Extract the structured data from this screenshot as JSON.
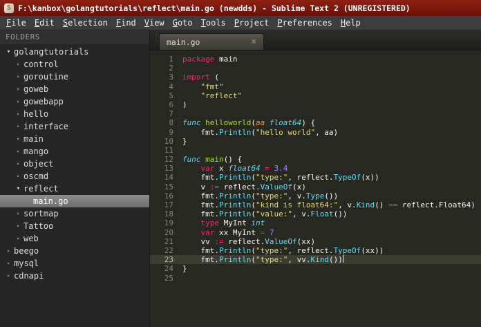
{
  "titlebar": {
    "icon_letter": "S",
    "title": "F:\\kanbox\\golangtutorials\\reflect\\main.go (newdds) - Sublime Text 2 (UNREGISTERED)"
  },
  "menu": {
    "items": [
      "File",
      "Edit",
      "Selection",
      "Find",
      "View",
      "Goto",
      "Tools",
      "Project",
      "Preferences",
      "Help"
    ]
  },
  "sidebar": {
    "header": "FOLDERS",
    "items": [
      {
        "label": "golangtutorials",
        "depth": 0,
        "kind": "folder",
        "state": "expanded",
        "selected": false
      },
      {
        "label": "control",
        "depth": 1,
        "kind": "folder",
        "state": "collapsed",
        "selected": false
      },
      {
        "label": "goroutine",
        "depth": 1,
        "kind": "folder",
        "state": "collapsed",
        "selected": false
      },
      {
        "label": "goweb",
        "depth": 1,
        "kind": "folder",
        "state": "collapsed",
        "selected": false
      },
      {
        "label": "gowebapp",
        "depth": 1,
        "kind": "folder",
        "state": "collapsed",
        "selected": false
      },
      {
        "label": "hello",
        "depth": 1,
        "kind": "folder",
        "state": "collapsed",
        "selected": false
      },
      {
        "label": "interface",
        "depth": 1,
        "kind": "folder",
        "state": "collapsed",
        "selected": false
      },
      {
        "label": "main",
        "depth": 1,
        "kind": "folder",
        "state": "collapsed",
        "selected": false
      },
      {
        "label": "mango",
        "depth": 1,
        "kind": "folder",
        "state": "collapsed",
        "selected": false
      },
      {
        "label": "object",
        "depth": 1,
        "kind": "folder",
        "state": "collapsed",
        "selected": false
      },
      {
        "label": "oscmd",
        "depth": 1,
        "kind": "folder",
        "state": "collapsed",
        "selected": false
      },
      {
        "label": "reflect",
        "depth": 1,
        "kind": "folder",
        "state": "expanded",
        "selected": false
      },
      {
        "label": "main.go",
        "depth": 2,
        "kind": "file",
        "state": "none",
        "selected": true
      },
      {
        "label": "sortmap",
        "depth": 1,
        "kind": "folder",
        "state": "collapsed",
        "selected": false
      },
      {
        "label": "Tattoo",
        "depth": 1,
        "kind": "folder",
        "state": "collapsed",
        "selected": false
      },
      {
        "label": "web",
        "depth": 1,
        "kind": "folder",
        "state": "collapsed",
        "selected": false
      },
      {
        "label": "beego",
        "depth": 0,
        "kind": "folder",
        "state": "collapsed",
        "selected": false
      },
      {
        "label": "mysql",
        "depth": 0,
        "kind": "folder",
        "state": "collapsed",
        "selected": false
      },
      {
        "label": "cdnapi",
        "depth": 0,
        "kind": "folder",
        "state": "collapsed",
        "selected": false
      }
    ]
  },
  "tab": {
    "label": "main.go",
    "close_glyph": "×"
  },
  "editor": {
    "active_line": 23,
    "lines": [
      {
        "n": 1,
        "segs": [
          [
            "package",
            "kw"
          ],
          [
            " main",
            "pl"
          ]
        ]
      },
      {
        "n": 2,
        "segs": []
      },
      {
        "n": 3,
        "segs": [
          [
            "import",
            "kw"
          ],
          [
            " (",
            "pl"
          ]
        ]
      },
      {
        "n": 4,
        "segs": [
          [
            "    ",
            "pl"
          ],
          [
            "\"fmt\"",
            "st"
          ]
        ]
      },
      {
        "n": 5,
        "segs": [
          [
            "    ",
            "pl"
          ],
          [
            "\"reflect\"",
            "st"
          ]
        ]
      },
      {
        "n": 6,
        "segs": [
          [
            ")",
            "pl"
          ]
        ]
      },
      {
        "n": 7,
        "segs": []
      },
      {
        "n": 8,
        "segs": [
          [
            "func",
            "ty"
          ],
          [
            " ",
            "pl"
          ],
          [
            "helloworld",
            "fn"
          ],
          [
            "(",
            "pl"
          ],
          [
            "aa",
            "pm"
          ],
          [
            " ",
            "pl"
          ],
          [
            "float64",
            "ty"
          ],
          [
            ") {",
            "pl"
          ]
        ]
      },
      {
        "n": 9,
        "segs": [
          [
            "    fmt.",
            "pl"
          ],
          [
            "Println",
            "sf"
          ],
          [
            "(",
            "pl"
          ],
          [
            "\"hello world\"",
            "st"
          ],
          [
            ", aa)",
            "pl"
          ]
        ]
      },
      {
        "n": 10,
        "segs": [
          [
            "}",
            "pl"
          ]
        ]
      },
      {
        "n": 11,
        "segs": []
      },
      {
        "n": 12,
        "segs": [
          [
            "func",
            "ty"
          ],
          [
            " ",
            "pl"
          ],
          [
            "main",
            "fn"
          ],
          [
            "() {",
            "pl"
          ]
        ]
      },
      {
        "n": 13,
        "segs": [
          [
            "    ",
            "pl"
          ],
          [
            "var",
            "kw"
          ],
          [
            " x ",
            "pl"
          ],
          [
            "float64",
            "ty"
          ],
          [
            " ",
            "pl"
          ],
          [
            "=",
            "op"
          ],
          [
            " ",
            "pl"
          ],
          [
            "3.4",
            "nm"
          ]
        ]
      },
      {
        "n": 14,
        "segs": [
          [
            "    fmt.",
            "pl"
          ],
          [
            "Println",
            "sf"
          ],
          [
            "(",
            "pl"
          ],
          [
            "\"type:\"",
            "st"
          ],
          [
            ", reflect.",
            "pl"
          ],
          [
            "TypeOf",
            "sf"
          ],
          [
            "(x))",
            "pl"
          ]
        ]
      },
      {
        "n": 15,
        "segs": [
          [
            "    v ",
            "pl"
          ],
          [
            ":=",
            "op"
          ],
          [
            " reflect.",
            "pl"
          ],
          [
            "ValueOf",
            "sf"
          ],
          [
            "(x)",
            "pl"
          ]
        ]
      },
      {
        "n": 16,
        "segs": [
          [
            "    fmt.",
            "pl"
          ],
          [
            "Println",
            "sf"
          ],
          [
            "(",
            "pl"
          ],
          [
            "\"type:\"",
            "st"
          ],
          [
            ", v.",
            "pl"
          ],
          [
            "Type",
            "sf"
          ],
          [
            "())",
            "pl"
          ]
        ]
      },
      {
        "n": 17,
        "segs": [
          [
            "    fmt.",
            "pl"
          ],
          [
            "Println",
            "sf"
          ],
          [
            "(",
            "pl"
          ],
          [
            "\"kind is float64:\"",
            "st"
          ],
          [
            ", v.",
            "pl"
          ],
          [
            "Kind",
            "sf"
          ],
          [
            "() ",
            "pl"
          ],
          [
            "==",
            "op"
          ],
          [
            " reflect.Float64)",
            "pl"
          ]
        ]
      },
      {
        "n": 18,
        "segs": [
          [
            "    fmt.",
            "pl"
          ],
          [
            "Println",
            "sf"
          ],
          [
            "(",
            "pl"
          ],
          [
            "\"value:\"",
            "st"
          ],
          [
            ", v.",
            "pl"
          ],
          [
            "Float",
            "sf"
          ],
          [
            "())",
            "pl"
          ]
        ]
      },
      {
        "n": 19,
        "segs": [
          [
            "    ",
            "pl"
          ],
          [
            "type",
            "kw"
          ],
          [
            " MyInt ",
            "pl"
          ],
          [
            "int",
            "ty"
          ]
        ]
      },
      {
        "n": 20,
        "segs": [
          [
            "    ",
            "pl"
          ],
          [
            "var",
            "kw"
          ],
          [
            " xx MyInt ",
            "pl"
          ],
          [
            "=",
            "op"
          ],
          [
            " ",
            "pl"
          ],
          [
            "7",
            "nm"
          ]
        ]
      },
      {
        "n": 21,
        "segs": [
          [
            "    vv ",
            "pl"
          ],
          [
            ":=",
            "op"
          ],
          [
            " reflect.",
            "pl"
          ],
          [
            "ValueOf",
            "sf"
          ],
          [
            "(xx)",
            "pl"
          ]
        ]
      },
      {
        "n": 22,
        "segs": [
          [
            "    fmt.",
            "pl"
          ],
          [
            "Println",
            "sf"
          ],
          [
            "(",
            "pl"
          ],
          [
            "\"type:\"",
            "st"
          ],
          [
            ", reflect.",
            "pl"
          ],
          [
            "TypeOf",
            "sf"
          ],
          [
            "(xx))",
            "pl"
          ]
        ]
      },
      {
        "n": 23,
        "segs": [
          [
            "    fmt.",
            "pl"
          ],
          [
            "Println",
            "sf"
          ],
          [
            "(",
            "pl"
          ],
          [
            "\"type:\"",
            "st"
          ],
          [
            ", vv.",
            "pl"
          ],
          [
            "Kind",
            "sf"
          ],
          [
            "())",
            "pl"
          ]
        ]
      },
      {
        "n": 24,
        "segs": [
          [
            "}",
            "pl"
          ]
        ]
      },
      {
        "n": 25,
        "segs": []
      }
    ]
  },
  "colors": {
    "titlebar_bg": "#7c1a0d",
    "menubar_bg": "#3c3c3c",
    "sidebar_bg": "#262626",
    "editor_bg": "#272822",
    "active_line_bg": "#3e3d32",
    "keyword": "#f92672",
    "string": "#e6db74",
    "number": "#ae81ff",
    "function_name": "#a6e22e",
    "support_function": "#66d9ef",
    "type": "#66d9ef",
    "parameter": "#fd971f",
    "plain_text": "#f8f8f2",
    "line_number": "#84857c"
  }
}
